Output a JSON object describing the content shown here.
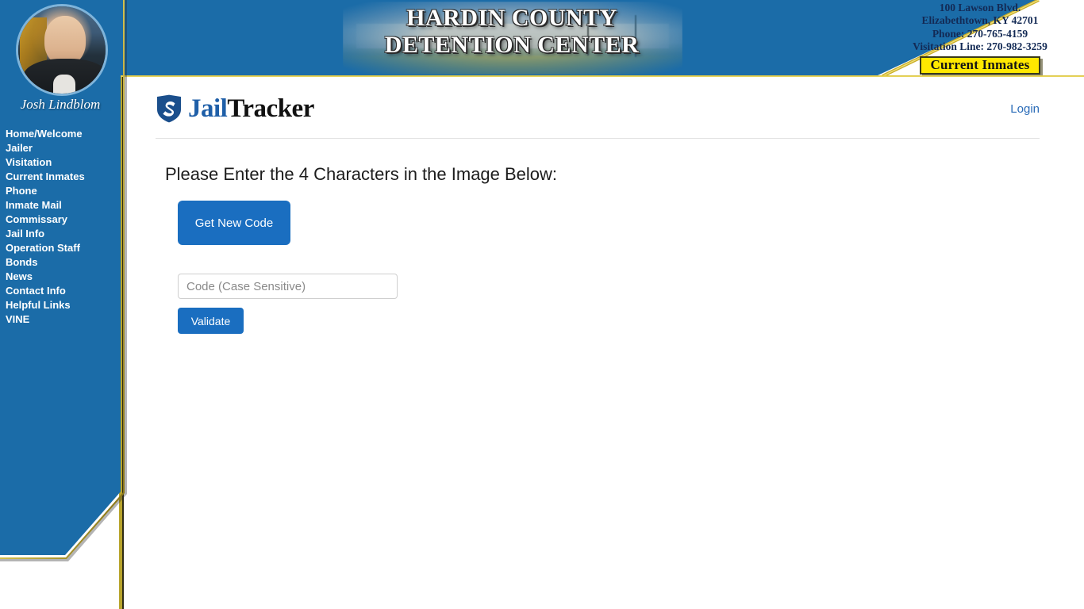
{
  "header": {
    "title_line1": "HARDIN COUNTY",
    "title_line2": "DETENTION CENTER",
    "contact": {
      "address": "100 Lawson Blvd.",
      "city_state_zip": "Elizabethtown, KY 42701",
      "phone": "Phone: 270-765-4159",
      "visitation_line": "Visitation Line: 270-982-3259",
      "current_inmates_button": "Current Inmates"
    }
  },
  "sidebar": {
    "officer_name": "Josh Lindblom",
    "items": [
      {
        "label": "Home/Welcome"
      },
      {
        "label": "Jailer"
      },
      {
        "label": "Visitation"
      },
      {
        "label": "Current Inmates"
      },
      {
        "label": "Phone"
      },
      {
        "label": "Inmate Mail"
      },
      {
        "label": "Commissary"
      },
      {
        "label": "Jail Info"
      },
      {
        "label": "Operation Staff"
      },
      {
        "label": "Bonds"
      },
      {
        "label": "News"
      },
      {
        "label": "Contact Info"
      },
      {
        "label": "Helpful Links"
      },
      {
        "label": "VINE"
      }
    ]
  },
  "app": {
    "logo_part1": "Jail",
    "logo_part2": "Tracker",
    "login_label": "Login"
  },
  "main": {
    "heading": "Please Enter the 4 Characters in the Image Below:",
    "get_new_code_label": "Get New Code",
    "code_placeholder": "Code (Case Sensitive)",
    "code_value": "",
    "validate_label": "Validate"
  },
  "colors": {
    "brand_blue": "#1b6ca8",
    "gold": "#d9c444",
    "button_blue": "#1a6ec0",
    "yellow_button": "#ffe800",
    "logo_blue": "#1f5fa8"
  }
}
